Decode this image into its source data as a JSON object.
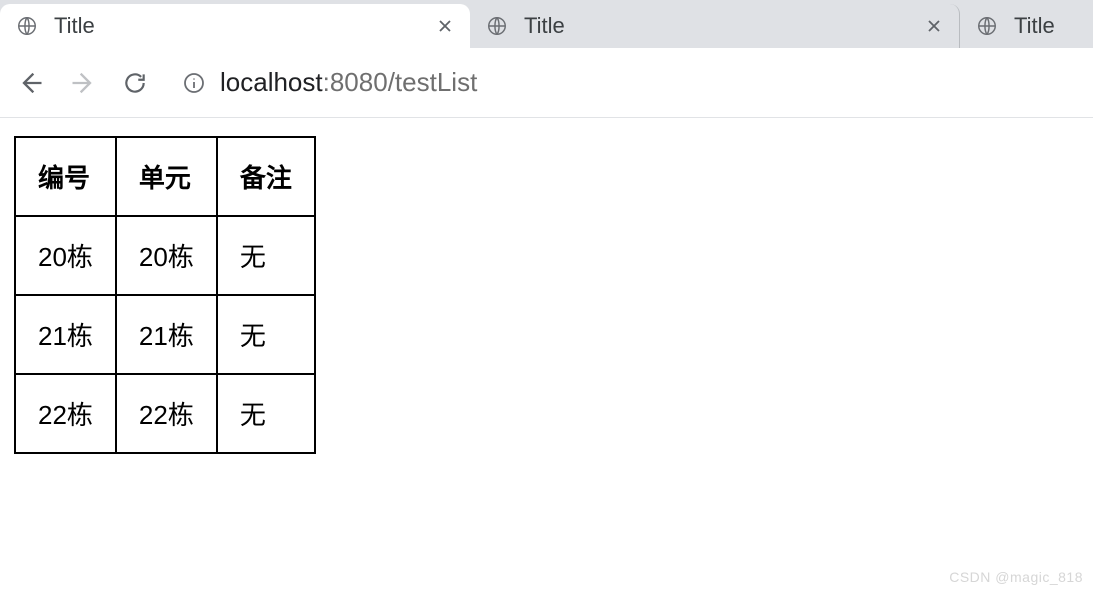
{
  "tabs": [
    {
      "title": "Title",
      "active": true
    },
    {
      "title": "Title",
      "active": false
    },
    {
      "title": "Title",
      "active": false
    }
  ],
  "address": {
    "host": "localhost",
    "port": ":8080",
    "path": "/testList"
  },
  "table": {
    "headers": [
      "编号",
      "单元",
      "备注"
    ],
    "rows": [
      [
        "20栋",
        "20栋",
        "无"
      ],
      [
        "21栋",
        "21栋",
        "无"
      ],
      [
        "22栋",
        "22栋",
        "无"
      ]
    ]
  },
  "watermark": "CSDN @magic_818"
}
